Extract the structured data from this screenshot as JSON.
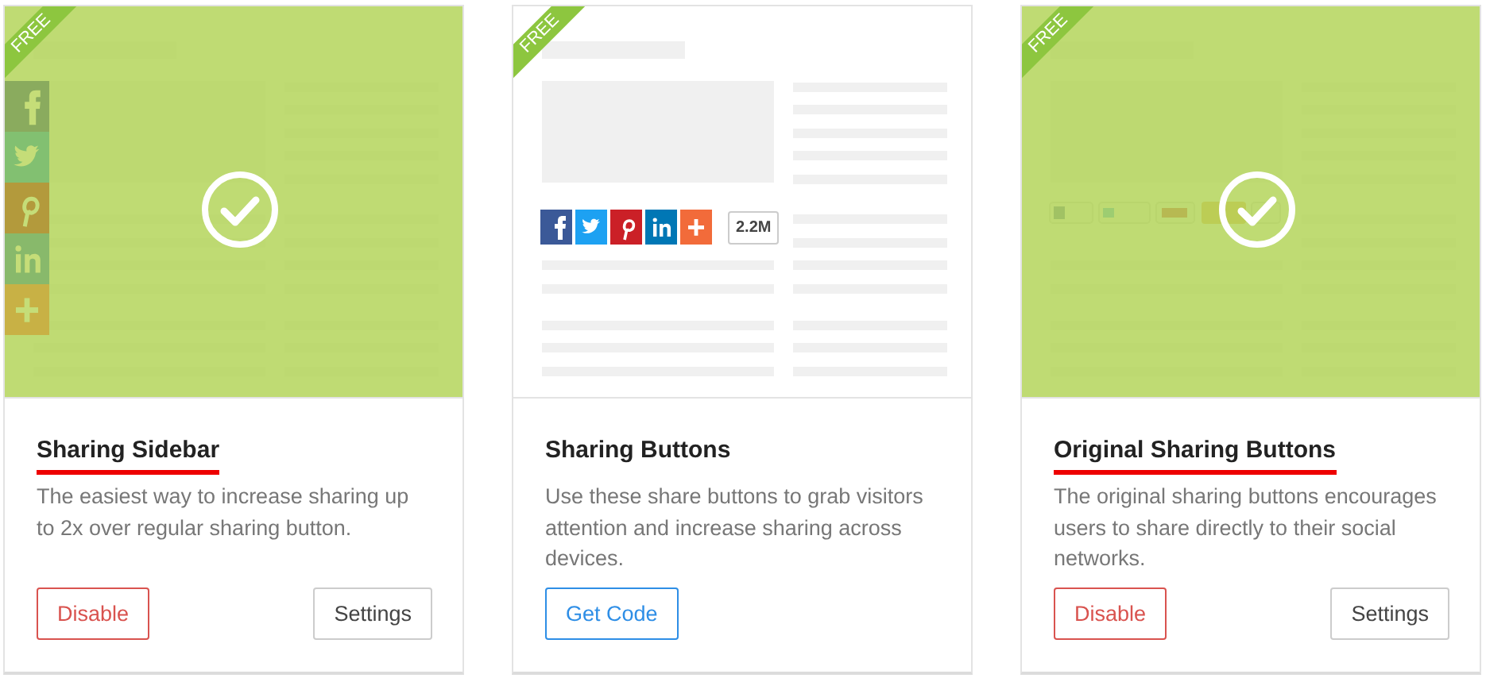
{
  "cards": [
    {
      "ribbon": "FREE",
      "active": true,
      "preview": {
        "kind": "sidebar"
      },
      "title": "Sharing Sidebar",
      "underlined": true,
      "description": "The easiest way to increase sharing up to 2x over regular sharing button.",
      "buttons": [
        {
          "label": "Disable",
          "kind": "danger"
        },
        {
          "label": "Settings",
          "kind": "default"
        }
      ]
    },
    {
      "ribbon": "FREE",
      "active": false,
      "preview": {
        "kind": "buttons",
        "count": "2.2M"
      },
      "title": "Sharing Buttons",
      "underlined": false,
      "description": "Use these share buttons to grab visitors attention and increase sharing across devices.",
      "buttons": [
        {
          "label": "Get Code",
          "kind": "primary"
        }
      ]
    },
    {
      "ribbon": "FREE",
      "active": true,
      "preview": {
        "kind": "original"
      },
      "title": "Original Sharing Buttons",
      "underlined": true,
      "description": "The original sharing buttons encourages users to share directly to their social networks.",
      "buttons": [
        {
          "label": "Disable",
          "kind": "danger"
        },
        {
          "label": "Settings",
          "kind": "default"
        }
      ]
    }
  ]
}
